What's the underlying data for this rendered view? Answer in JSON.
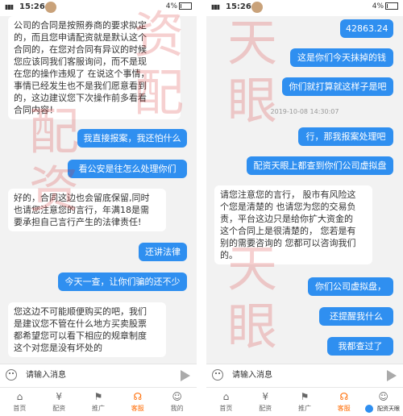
{
  "status": {
    "time": "15:26",
    "battery": "4%",
    "network": "4G"
  },
  "left": {
    "messages": [
      {
        "side": "in",
        "text": "公司的合同是按照券商的要求拟定\n的，而且您申请配资就是默认这个\n合同的，在您对合同有异议的时候\n您应该同我们客服询问，而不是现\n在您的操作违规了  在说这个事情，\n事情已经发生也不是我们愿意看到\n的，这边建议您下次操作前多看看\n合同内容！"
      },
      {
        "side": "out",
        "text": "我直接报案，我还怕什么"
      },
      {
        "side": "out",
        "text": "看公安是往怎么处理你们"
      },
      {
        "side": "in",
        "text": "好的，合同这边也会留底保留,同时\n也请您注意您的言行，年满18是需\n要承担自己言行产生的法律责任!"
      },
      {
        "side": "out",
        "text": "还讲法律"
      },
      {
        "side": "out",
        "text": "今天一查，让你们骗的还不少"
      },
      {
        "side": "in",
        "text": "您这边不可能顺便购买的吧，我们\n是建议您不管在什么地方买卖股票\n都希望您可以看下相应的规章制度\n这个对您是没有坏处的"
      }
    ],
    "watermark": [
      "配",
      "资"
    ],
    "watermark2": [
      "资",
      "配"
    ]
  },
  "right": {
    "messages": [
      {
        "side": "out",
        "text": "42863.24"
      },
      {
        "side": "out",
        "text": "这是你们今天抹掉的钱"
      },
      {
        "side": "out",
        "text": "你们就打算就这样子是吧"
      },
      {
        "side": "out",
        "text": "行，那我报案处理吧"
      },
      {
        "side": "out",
        "text": "配资天眼上都查到你们公司虚拟盘"
      },
      {
        "side": "in",
        "text": "请您注意您的言行，  股市有风险这\n个您是清楚的  也请您为您的交易负\n责，平台这边只是给你扩大资金的\n这个合同上是很清楚的，  您若是有\n别的需要咨询的  您都可以咨询我们\n的。"
      },
      {
        "side": "out",
        "text": "你们公司虚拟盘，"
      },
      {
        "side": "out",
        "text": "还提醒我什么"
      },
      {
        "side": "out",
        "text": "我都查过了"
      }
    ],
    "timestamp": "2019-10-08 14:30:07",
    "watermark": [
      "天",
      "眼"
    ],
    "watermark2": [
      "天",
      "眼"
    ]
  },
  "input": {
    "placeholder": "请输入消息"
  },
  "tabs": [
    "首页",
    "配资",
    "推广",
    "客服",
    "我的"
  ],
  "badge": "配资天眼",
  "colors": {
    "accent": "#2f8ff0",
    "active_tab": "#ff6a00",
    "watermark": "#d72828"
  }
}
